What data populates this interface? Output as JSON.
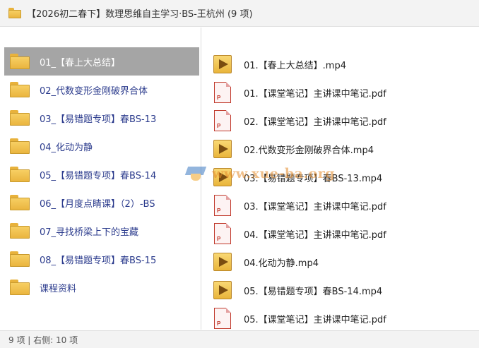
{
  "window": {
    "title": "【2026初二春下】数理思维自主学习·BS-王杭州 (9 项)"
  },
  "left_pane": {
    "items": [
      {
        "label": "01_【春上大总结】",
        "selected": true
      },
      {
        "label": "02_代数变形金刚破界合体",
        "selected": false
      },
      {
        "label": "03_【易错题专项】春BS-13",
        "selected": false
      },
      {
        "label": "04_化动为静",
        "selected": false
      },
      {
        "label": "05_【易错题专项】春BS-14",
        "selected": false
      },
      {
        "label": "06_【月度点睛课】（2）-BS",
        "selected": false
      },
      {
        "label": "07_寻找桥梁上下的宝藏",
        "selected": false
      },
      {
        "label": "08_【易错题专项】春BS-15",
        "selected": false
      },
      {
        "label": "课程资料",
        "selected": false
      }
    ]
  },
  "right_pane": {
    "items": [
      {
        "label": "01.【春上大总结】.mp4",
        "icon": "mp4-file-icon"
      },
      {
        "label": "01.【课堂笔记】主讲课中笔记.pdf",
        "icon": "pdf-file-icon"
      },
      {
        "label": "02.【课堂笔记】主讲课中笔记.pdf",
        "icon": "pdf-file-icon"
      },
      {
        "label": "02.代数变形金刚破界合体.mp4",
        "icon": "mp4-file-icon"
      },
      {
        "label": "03.【易错题专项】春BS-13.mp4",
        "icon": "mp4-file-icon"
      },
      {
        "label": "03.【课堂笔记】主讲课中笔记.pdf",
        "icon": "pdf-file-icon"
      },
      {
        "label": "04.【课堂笔记】主讲课中笔记.pdf",
        "icon": "pdf-file-icon"
      },
      {
        "label": "04.化动为静.mp4",
        "icon": "mp4-file-icon"
      },
      {
        "label": "05.【易错题专项】春BS-14.mp4",
        "icon": "mp4-file-icon"
      },
      {
        "label": "05.【课堂笔记】主讲课中笔记.pdf",
        "icon": "pdf-file-icon"
      }
    ]
  },
  "status": {
    "text": "9 项 | 右侧: 10 项"
  },
  "watermark": {
    "text": "www.xue-ba.org"
  },
  "colors": {
    "folder": "#f2c14e",
    "selected_row": "#a5a5a5",
    "folder_label": "#2a3a8c",
    "pdf": "#c0392b"
  }
}
